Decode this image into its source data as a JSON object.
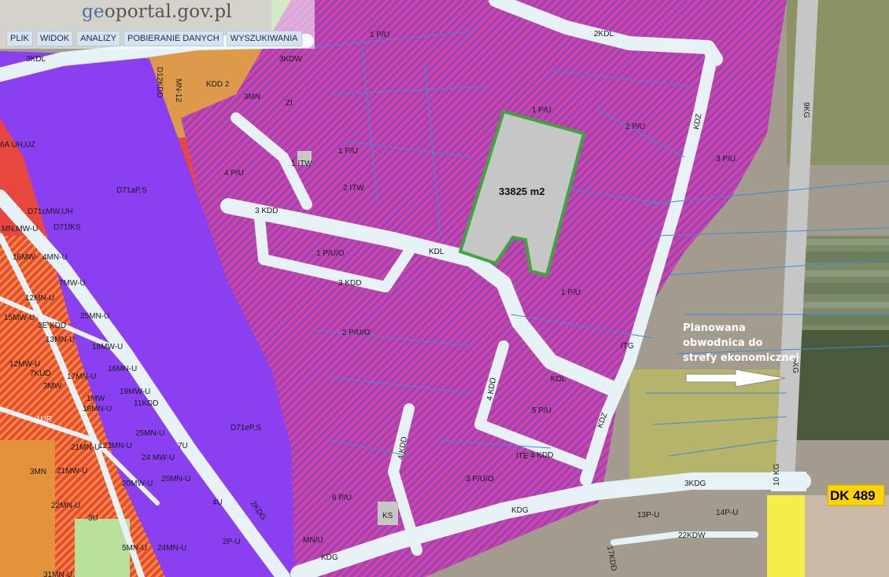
{
  "portal": {
    "name_prefix": "ge",
    "name_suffix": "oportal.gov.pl"
  },
  "menu": [
    "PLIK",
    "WIDOK",
    "ANALIZY",
    "POBIERANIE DANYCH",
    "WYSZUKIWANIA"
  ],
  "parcel": {
    "area_label": "33825 m2"
  },
  "annotation": {
    "line1": "Planowana",
    "line2": "obwodnica do",
    "line3": "strefy ekonomicznej"
  },
  "road_badge": {
    "label": "DK 489"
  },
  "colors": {
    "industrial": "#d8429a",
    "stripe": "#7a4ec8",
    "service": "#8a3ff0",
    "residential": "#e8473f",
    "road": "#e6f2f6",
    "parcel_fill": "#c6c6c6",
    "parcel_border": "#3ca83c",
    "badge": "#ffd400"
  },
  "labels": {
    "p1": "1 P/U",
    "p2": "2 P/U",
    "p3": "3 P/U",
    "p4": "4 P/U",
    "p5": "5 P/U",
    "p6": "6 P/U",
    "p7": "3 P/U/O",
    "p8": "2 P/U/O",
    "p9": "1 P/U/O",
    "itw1": "1 ITW",
    "itw2": "2 ITW",
    "itg": "ITG",
    "ite": "ITE",
    "ks": "KS",
    "kdl": "KDL",
    "kdl2": "2KDL",
    "kdl3": "3KDL",
    "kdz": "KDZ",
    "kdz2": "KDZ",
    "kdd3": "3 KDD",
    "kdd3b": "3 KDD",
    "kdd4": "4 KDD",
    "kdd4b": "4 KDD",
    "kdd4c": "4 KDD",
    "kdg": "KDG",
    "kdg2": "KDG",
    "kdg3": "3KDG",
    "kdg2k": "2KDG",
    "kg9": "9KG",
    "kg9b": "9KG",
    "kg10": "10 KG",
    "d71ap": "D71aP,S",
    "d71ep": "D71eP,S",
    "d71c": "D71cMW,UH",
    "d71f": "D71fKS",
    "mnmw": "MN,MW-U",
    "mw16": "16MW-",
    "mnu4": "4MN-U",
    "mwu7": "7MW-U",
    "mnu12": "12MN-U",
    "mwu15": "15MW-U",
    "mw3e": "3E KDD",
    "mwu25": "25MN-U",
    "mnu13": "13MN-U",
    "mwu18": "18MW-U",
    "mwu12": "12MW-U",
    "mnu16": "16MN-U",
    "mnu17": "17MN-U",
    "kud7": "7KUD",
    "mw3": "3MW",
    "mwu19": "19MW-U",
    "mw1": "1MW",
    "mnu18": "18MN-U",
    "kdd11": "11KDD",
    "ur1": "1UR",
    "mnu25": "25MN-U",
    "mnu23": "123MN-U",
    "mnu21": "21MN-U",
    "mwu24": "24 MW-U",
    "mwu21": "21MW-U",
    "mwu20": "20MW-U",
    "mnu26": "26MN-U",
    "mnu22": "22MN-U",
    "u3": "3U",
    "u4": "4U",
    "pu2": "2P-U",
    "mnu5": "5MN-U",
    "mnu24": "24MN-U",
    "mnu31": "31MN-U",
    "u7": "7U",
    "mnu": "MN/U",
    "pu13": "13P-U",
    "pu14": "14P-U",
    "kdw22": "22KDW",
    "kdd17": "17KDD",
    "mn3": "3MN",
    "kdw3": "3KDW",
    "kdd2": "KDD 2",
    "zi": "ZI",
    "mn12": "MN-12",
    "uhuz": "6A UH,UZ",
    "mn3b": "3MN",
    "kdd12": "D12KDD"
  }
}
